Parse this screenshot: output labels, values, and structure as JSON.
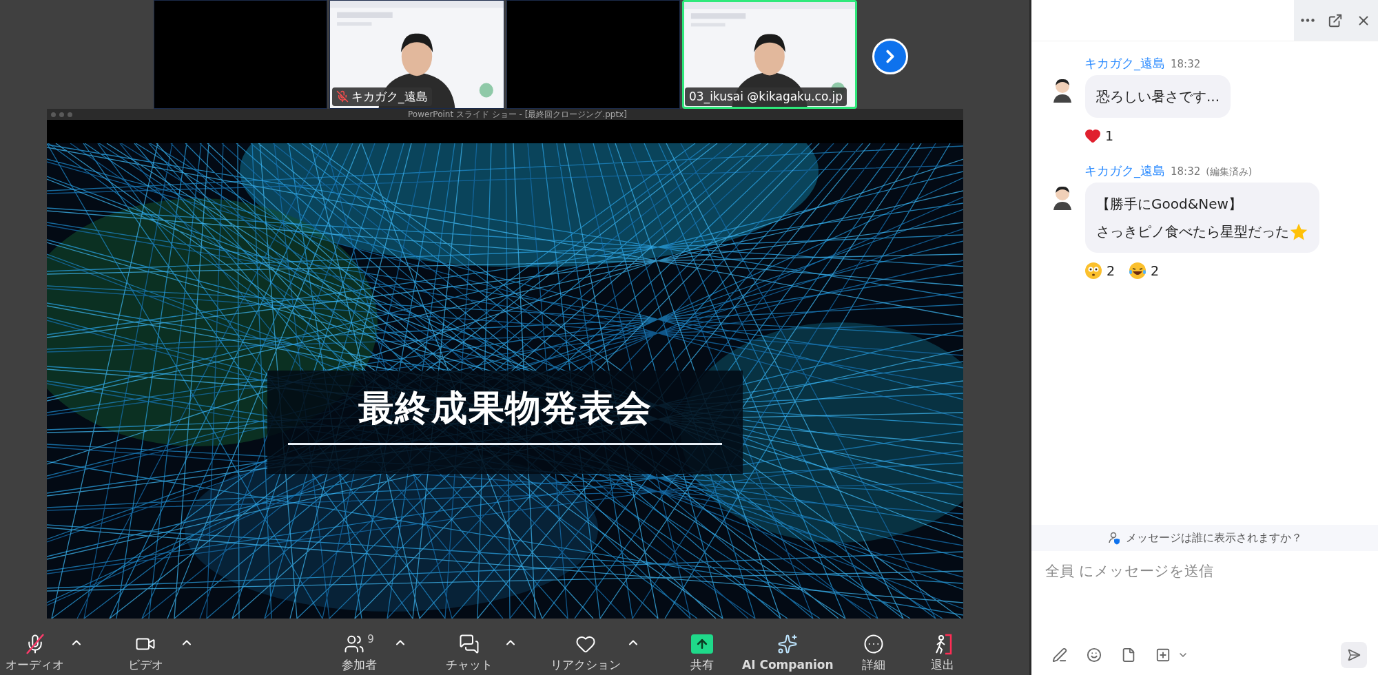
{
  "video_strip": {
    "tiles": [
      {
        "kind": "empty"
      },
      {
        "kind": "video",
        "name": "キカガク_遠島",
        "muted": true,
        "speaking": false
      },
      {
        "kind": "empty"
      },
      {
        "kind": "video",
        "name": "03_ikusai @kikagaku.co.jp",
        "muted": false,
        "speaking": true
      }
    ]
  },
  "shared_window": {
    "title": "PowerPoint スライド ショー - [最終回クロージング.pptx]",
    "slide_title": "最終成果物発表会"
  },
  "toolbar": {
    "items": [
      {
        "kind": "audio",
        "label": "オーディオ",
        "off": true,
        "menu": true
      },
      {
        "kind": "video",
        "label": "ビデオ",
        "off": false,
        "menu": true
      },
      {
        "kind": "participants",
        "label": "参加者",
        "count": "9",
        "menu": true
      },
      {
        "kind": "chat",
        "label": "チャット",
        "menu": true
      },
      {
        "kind": "reactions",
        "label": "リアクション",
        "menu": true
      },
      {
        "kind": "share",
        "label": "共有",
        "menu": false
      },
      {
        "kind": "ai",
        "label": "AI Companion",
        "menu": false
      },
      {
        "kind": "more",
        "label": "詳細",
        "menu": false
      },
      {
        "kind": "leave",
        "label": "退出",
        "menu": false
      }
    ]
  },
  "chat": {
    "messages": [
      {
        "sender": "キカガク_遠島",
        "time": "18:32",
        "lines": [
          "恐ろしい暑さです..."
        ],
        "reactions": [
          {
            "kind": "heart",
            "count": "1"
          }
        ]
      },
      {
        "sender": "キカガク_遠島",
        "time": "18:32",
        "note": "(編集済み)",
        "lines": [
          "【勝手にGood&New】",
          "さっきピノ食べたら星型だった"
        ],
        "star": true,
        "reactions": [
          {
            "kind": "flushed",
            "count": "2"
          },
          {
            "kind": "laughing",
            "count": "2"
          }
        ]
      }
    ],
    "notice": "メッセージは誰に表示されますか？",
    "input": {
      "placeholder": "全員 にメッセージを送信"
    }
  }
}
